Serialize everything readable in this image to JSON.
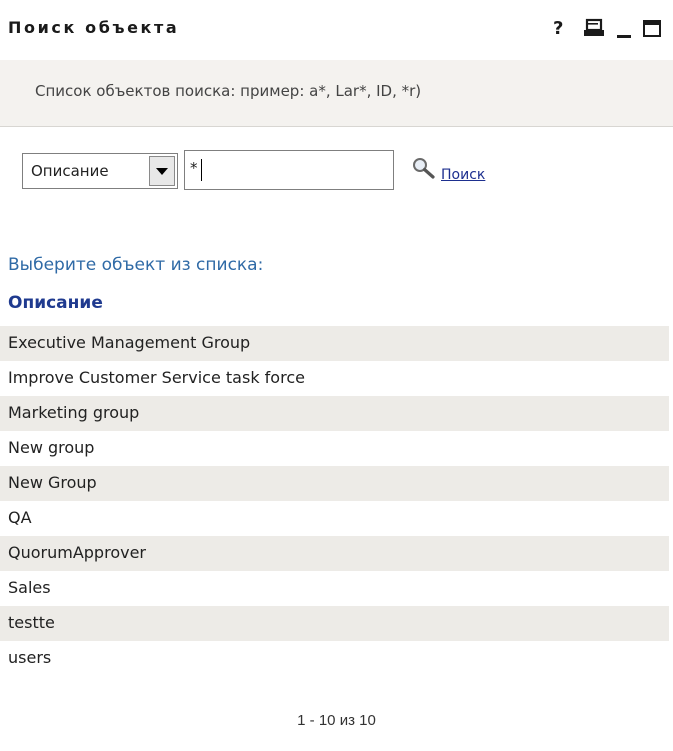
{
  "window": {
    "title": "Поиск объекта",
    "help_label": "?",
    "icons": [
      "help-icon",
      "print-icon",
      "minimize-icon",
      "maximize-icon"
    ]
  },
  "instruction": "Список объектов поиска: пример: a*, Lar*, ID, *r)",
  "search": {
    "attribute_selected": "Описание",
    "query_value": "*",
    "button_label": "Поиск"
  },
  "results": {
    "heading": "Выберите объект из списка:",
    "column_header": "Описание",
    "rows": [
      "Executive Management Group",
      "Improve Customer Service task force",
      "Marketing group",
      "New group",
      "New Group",
      "QA",
      "QuorumApprover",
      "Sales",
      "testte",
      "users"
    ],
    "pagination": "1 - 10 из 10"
  },
  "colors": {
    "heading": "#2f6aa6",
    "column_header": "#1f3a8f",
    "link": "#1d2f8f",
    "row_shade": "#edebe7",
    "instruction_bg": "#f4f2ef"
  }
}
